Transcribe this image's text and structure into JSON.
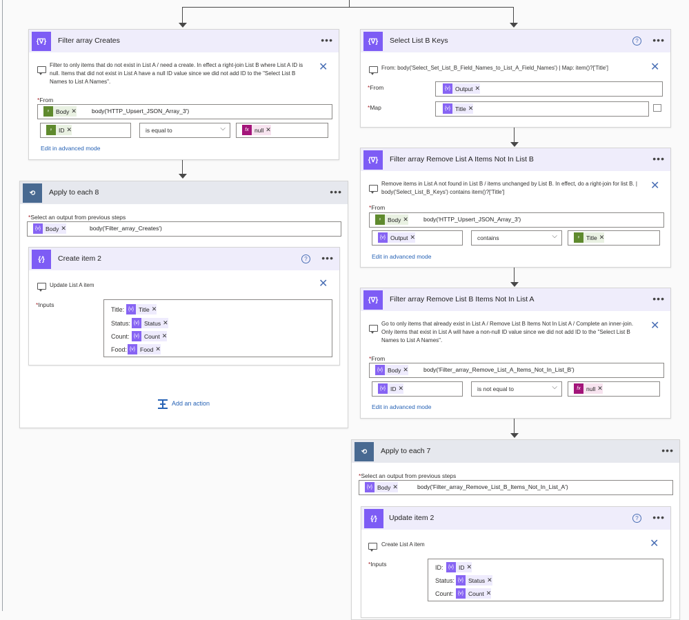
{
  "filter_creates": {
    "title": "Filter array Creates",
    "note": "Filter to only items that do not exist in List A / need a create. In effect a right-join List B where List A ID is null. Items that did not exist in List A have a null ID value since we did not add ID to the \"Select List B Names to List A Names\".",
    "from_label": "From",
    "from_token": "Body",
    "from_expr": "body('HTTP_Upsert_JSON_Array_3')",
    "left_token": "ID",
    "operator": "is equal to",
    "right_token": "null",
    "advanced_link": "Edit in advanced mode"
  },
  "apply8": {
    "title": "Apply to each 8",
    "select_label": "Select an output from previous steps",
    "token": "Body",
    "expr": "body('Filter_array_Creates')"
  },
  "create_item2": {
    "title": "Create item 2",
    "note": "Update List A item",
    "inputs_label": "Inputs",
    "rows": [
      {
        "key": "Title:",
        "token": "Title"
      },
      {
        "key": "Status:",
        "token": "Status"
      },
      {
        "key": "Count:",
        "token": "Count"
      },
      {
        "key": "Food:",
        "token": "Food"
      }
    ]
  },
  "add_action": "Add an action",
  "select_keys": {
    "title": "Select List B Keys",
    "note": "From: body('Select_Set_List_B_Field_Names_to_List_A_Field_Names') | Map: item()?['Title']",
    "from_label": "From",
    "from_token": "Output",
    "map_label": "Map",
    "map_token": "Title"
  },
  "filter_remove_a": {
    "title": "Filter array Remove List A Items Not In List B",
    "note": "Remove items in List A not found in List B / items unchanged by List B. In effect, do a right-join for list B. | body('Select_List_B_Keys') contains item()?['Title']",
    "from_label": "From",
    "from_token": "Body",
    "from_expr": "body('HTTP_Upsert_JSON_Array_3')",
    "left_token": "Output",
    "operator": "contains",
    "right_token": "Title",
    "advanced_link": "Edit in advanced mode"
  },
  "filter_remove_b": {
    "title": "Filter array Remove List B Items Not In List A",
    "note": "Go to only items that already exist in List A / Remove List B Items Not In List A / Complete an inner-join. Only items that exist in List A will have a non-null ID value since we did not add ID to the \"Select List B Names to List A Names\".",
    "from_label": "From",
    "from_token": "Body",
    "from_expr": "body('Filter_array_Remove_List_A_Items_Not_In_List_B')",
    "left_token": "ID",
    "operator": "is not equal to",
    "right_token": "null",
    "advanced_link": "Edit in advanced mode"
  },
  "apply7": {
    "title": "Apply to each 7",
    "select_label": "Select an output from previous steps",
    "token": "Body",
    "expr": "body('Filter_array_Remove_List_B_Items_Not_In_List_A')"
  },
  "update_item2": {
    "title": "Update item 2",
    "note": "Create List A item",
    "inputs_label": "Inputs",
    "rows": [
      {
        "key": "ID:",
        "token": "ID"
      },
      {
        "key": "Status:",
        "token": "Status"
      },
      {
        "key": "Count:",
        "token": "Count"
      }
    ]
  },
  "icons": {
    "data_op": "{∇}",
    "sharepoint": "{⁄}",
    "loop": "loop-icon",
    "expression": "fx",
    "variable": "{v}",
    "trigger": "bulb"
  },
  "colors": {
    "action_purple": "#7d5cf5",
    "loop_blue": "#486991",
    "link_blue": "#2662b5"
  }
}
